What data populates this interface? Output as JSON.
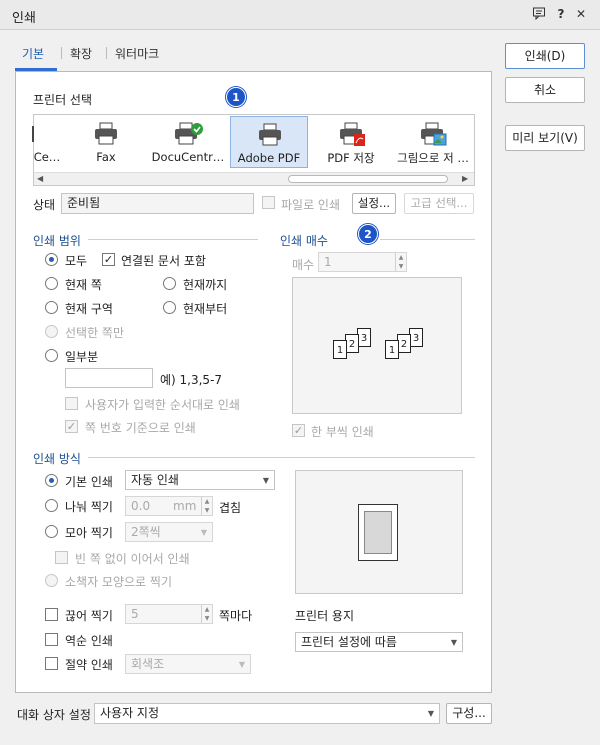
{
  "window": {
    "title": "인쇄"
  },
  "tabs": [
    "기본",
    "확장",
    "워터마크"
  ],
  "buttons": {
    "print": "인쇄(D)",
    "cancel": "취소",
    "preview": "미리 보기(V)"
  },
  "printer_select": {
    "title": "프린터 선택",
    "printers": [
      "Ce…",
      "Fax",
      "DocuCentr…",
      "Adobe PDF",
      "PDF 저장",
      "그림으로 저 …"
    ],
    "selected": "Adobe PDF",
    "badge1": "1"
  },
  "status": {
    "label": "상태",
    "value": "준비됨",
    "file_print": "파일로 인쇄",
    "settings": "설정...",
    "advanced": "고급 선택..."
  },
  "print_range": {
    "title": "인쇄 범위",
    "all": "모두",
    "linked": "연결된 문서 포함",
    "current_page": "현재 쪽",
    "to_current": "현재까지",
    "current_section": "현재 구역",
    "from_current": "현재부터",
    "selected_only": "선택한 쪽만",
    "partial": "일부분",
    "example": "예) 1,3,5-7",
    "user_order": "사용자가 입력한 순서대로 인쇄",
    "page_number_basis": "쪽 번호 기준으로 인쇄"
  },
  "copies": {
    "title": "인쇄 매수",
    "badge2": "2",
    "count_label": "매수",
    "count": "1",
    "collate": "한 부씩 인쇄"
  },
  "print_method": {
    "title": "인쇄 방식",
    "basic": "기본 인쇄",
    "basic_mode": "자동 인쇄",
    "split": "나눠 찍기",
    "split_value": "0.0",
    "split_unit": "mm",
    "overlap": "겹침",
    "gather": "모아 찍기",
    "gather_value": "2쪽씩",
    "no_blank": "빈 쪽 없이 이어서 인쇄",
    "booklet": "소책자 모양으로 찍기",
    "cut": "끊어 찍기",
    "cut_value": "5",
    "cut_unit": "쪽마다",
    "reverse": "역순 인쇄",
    "saving": "절약 인쇄",
    "saving_value": "회색조"
  },
  "paper": {
    "label": "프린터 용지",
    "value": "프린터 설정에 따름"
  },
  "dialog_settings": {
    "label": "대화 상자 설정",
    "value": "사용자 지정",
    "configure": "구성..."
  }
}
